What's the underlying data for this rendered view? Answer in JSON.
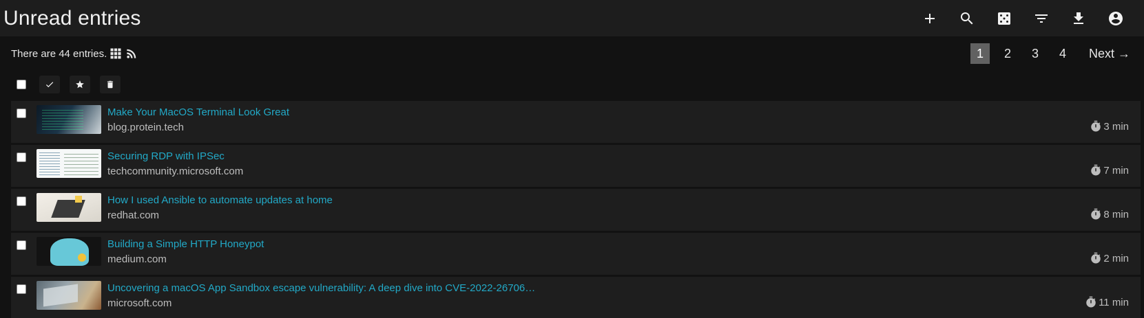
{
  "header": {
    "title": "Unread entries",
    "actions": [
      {
        "icon": "plus-icon",
        "label": "Add"
      },
      {
        "icon": "search-icon",
        "label": "Search"
      },
      {
        "icon": "dice-icon",
        "label": "Random"
      },
      {
        "icon": "filter-icon",
        "label": "Filter"
      },
      {
        "icon": "download-icon",
        "label": "Export"
      },
      {
        "icon": "account-icon",
        "label": "Account"
      }
    ]
  },
  "info": {
    "count_text": "There are 44 entries.",
    "view_icons": [
      "grid-view-icon",
      "rss-feed-icon"
    ]
  },
  "pagination": {
    "pages": [
      "1",
      "2",
      "3",
      "4"
    ],
    "current": "1",
    "next_label": "Next →"
  },
  "bulk_actions": [
    "select-all-checkbox",
    "mark-read-icon",
    "star-icon",
    "trash-icon"
  ],
  "entries": [
    {
      "title": "Make Your MacOS Terminal Look Great",
      "domain": "blog.protein.tech",
      "reading_time": "3 min"
    },
    {
      "title": "Securing RDP with IPSec",
      "domain": "techcommunity.microsoft.com",
      "reading_time": "7 min"
    },
    {
      "title": "How I used Ansible to automate updates at home",
      "domain": "redhat.com",
      "reading_time": "8 min"
    },
    {
      "title": "Building a Simple HTTP Honeypot",
      "domain": "medium.com",
      "reading_time": "2 min"
    },
    {
      "title": "Uncovering a macOS App Sandbox escape vulnerability: A deep dive into CVE-2022-26706…",
      "domain": "microsoft.com",
      "reading_time": "11 min"
    }
  ],
  "colors": {
    "background": "#121212",
    "topbar": "#1d1d1d",
    "row": "#1e1e1e",
    "link": "#22a9c7",
    "muted": "#bdbdbd",
    "active_page": "#616161"
  }
}
